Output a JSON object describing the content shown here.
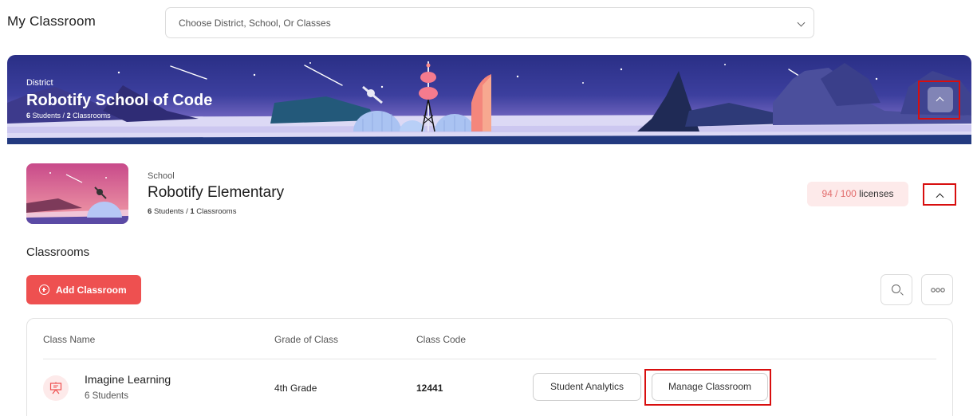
{
  "header": {
    "title": "My Classroom",
    "selector_placeholder": "Choose District, School, Or Classes",
    "selector_icon": "chevron-down-icon"
  },
  "district": {
    "label": "District",
    "name": "Robotify School of Code",
    "students_count": "6",
    "students_word": "Students /",
    "classrooms_count": "2",
    "classrooms_word": "Classrooms",
    "toggle_icon": "chevron-up-icon",
    "banner_colors": {
      "sky_top": "#2a2f86",
      "sky_bottom": "#a98fd5",
      "ground": "#dcd9f5"
    }
  },
  "school": {
    "label": "School",
    "name": "Robotify Elementary",
    "students_count": "6",
    "students_word": "Students /",
    "classrooms_count": "1",
    "classrooms_word": "Classrooms",
    "licenses_used": "94 / 100",
    "licenses_word": "licenses",
    "toggle_icon": "chevron-up-icon"
  },
  "classrooms": {
    "heading": "Classrooms",
    "add_label": "Add Classroom",
    "search_icon": "search-icon",
    "more_icon": "more-options-icon",
    "columns": [
      "Class Name",
      "Grade of Class",
      "Class Code"
    ],
    "rows": [
      {
        "name": "Imagine Learning",
        "students": "6 Students",
        "grade": "4th Grade",
        "code": "12441",
        "actions": [
          "Student Analytics",
          "Manage Classroom"
        ]
      }
    ]
  },
  "colors": {
    "accent": "#ee5050",
    "highlight_box": "#d80e0e",
    "license_bg": "#fdeaea"
  }
}
